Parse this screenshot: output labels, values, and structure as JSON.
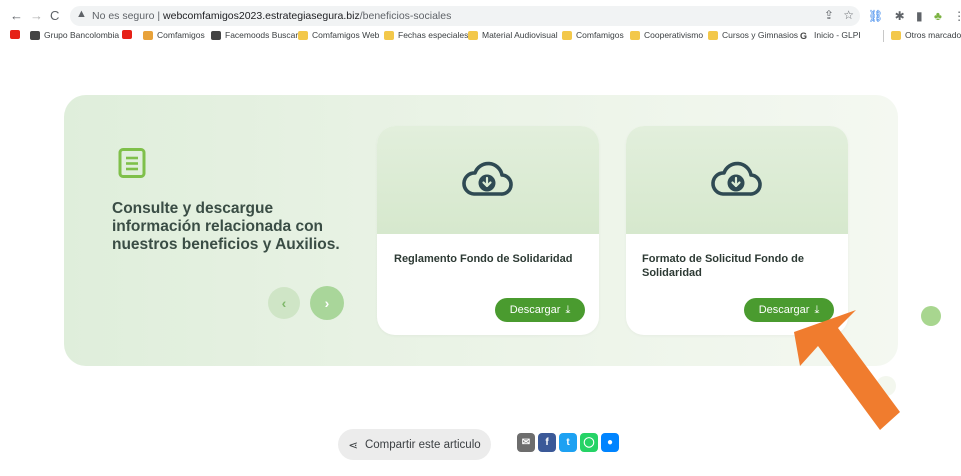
{
  "browser": {
    "security_label": "No es seguro",
    "url_domain": "webcomfamigos2023.estrategiasegura.biz",
    "url_path": "/beneficios-sociales",
    "nav": {
      "back": "←",
      "forward": "→",
      "reload": "C"
    },
    "omni_icons": [
      "share-icon",
      "star-icon"
    ],
    "extension_icons": [
      "link-icon",
      "puzzle-icon",
      "sidebar-icon",
      "extension-icon",
      "menu-icon"
    ],
    "bookmarks": [
      {
        "label": "",
        "icon": "youtube-icon"
      },
      {
        "label": "Grupo Bancolombia",
        "icon": "site-icon"
      },
      {
        "label": "",
        "icon": "youtube-icon"
      },
      {
        "label": "Comfamigos",
        "icon": "site-icon"
      },
      {
        "label": "Facemoods Buscar",
        "icon": "site-icon"
      },
      {
        "label": "Comfamigos Web",
        "icon": "folder-icon"
      },
      {
        "label": "Fechas especiales",
        "icon": "folder-icon"
      },
      {
        "label": "Material Audiovisual",
        "icon": "folder-icon"
      },
      {
        "label": "Comfamigos",
        "icon": "folder-icon"
      },
      {
        "label": "Cooperativismo",
        "icon": "folder-icon"
      },
      {
        "label": "Cursos y Gimnasios",
        "icon": "folder-icon"
      },
      {
        "label": "Inicio - GLPI",
        "icon": "g-icon"
      },
      {
        "label": "Otros marcadores",
        "icon": "folder-icon"
      }
    ]
  },
  "section": {
    "heading": "Consulte y descargue información relacionada con nuestros beneficios y Auxilios.",
    "prev_label": "‹",
    "next_label": "›",
    "accent_color": "#4a9b2f"
  },
  "cards": [
    {
      "title": "Reglamento Fondo de Solidaridad",
      "button": "Descargar"
    },
    {
      "title": "Formato de Solicitud Fondo de Solidaridad",
      "button": "Descargar"
    }
  ],
  "share": {
    "label": "Compartir este articulo",
    "buttons": [
      {
        "name": "email",
        "glyph": "✉",
        "color": "#6d6d6d"
      },
      {
        "name": "facebook",
        "glyph": "f",
        "color": "#3b5998"
      },
      {
        "name": "twitter",
        "glyph": "t",
        "color": "#1da1f2"
      },
      {
        "name": "whatsapp",
        "glyph": "◯",
        "color": "#25d366"
      },
      {
        "name": "messenger",
        "glyph": "●",
        "color": "#0084ff"
      }
    ]
  }
}
